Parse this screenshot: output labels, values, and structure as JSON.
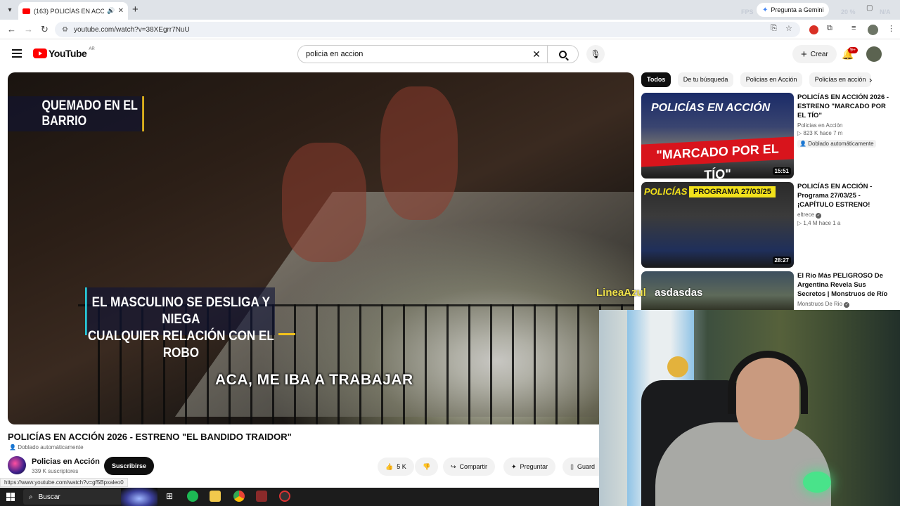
{
  "browser": {
    "tab_title": "(163) POLICÍAS EN ACCIÓN",
    "tab_audio_icon": "speaker-icon",
    "gemini_label": "Pregunta a Gemini",
    "url": "youtube.com/watch?v=38XEgrr7NuU",
    "faint_overlay": [
      "FPS",
      "20 %",
      "N/A"
    ]
  },
  "youtube": {
    "logo_text": "YouTube",
    "country_code": "AR",
    "search_query": "policia en accion",
    "create_label": "Crear",
    "notification_count": "9+",
    "accent_color": "#ff0000"
  },
  "video": {
    "overlay_top": "QUEMADO EN EL BARRIO",
    "overlay_mid_line1": "EL MASCULINO SE DESLIGA Y NIEGA",
    "overlay_mid_line2": "CUALQUIER RELACIÓN CON EL ROBO",
    "subtitle": "ACA, ME IBA A TRABAJAR",
    "title": "POLICÍAS EN ACCIÓN 2026 - ESTRENO \"EL BANDIDO TRAIDOR\"",
    "dubbed": "Doblado automáticamente",
    "channel_name": "Policias en Acción",
    "channel_subs": "339 K suscriptores",
    "subscribe_label": "Suscribirse",
    "likes": "5 K",
    "share_label": "Compartir",
    "ask_label": "Preguntar",
    "save_label": "Guard"
  },
  "status_bar": "https://www.youtube.com/watch?v=gf5Bpxaleo0",
  "chips": [
    "Todos",
    "De tu búsqueda",
    "Policias en Acción",
    "Policías en acción"
  ],
  "related": [
    {
      "title": "POLICÍAS EN ACCIÓN 2026 - ESTRENO \"MARCADO POR EL TÍO\"",
      "channel": "Policias en Acción",
      "views": "823 K",
      "age": "hace 7 m",
      "dubbed": "Doblado automáticamente",
      "duration": "15:51",
      "thumb_brand": "POLICÍAS EN ACCIÓN",
      "thumb_band": "\"MARCADO POR EL TÍO\""
    },
    {
      "title": "POLICÍAS EN ACCIÓN - Programa 27/03/25 - ¡CAPÍTULO ESTRENO!",
      "channel": "eltrece",
      "views": "1,4 M",
      "age": "hace 1 a",
      "duration": "28:27",
      "thumb_brand": "POLICÍAS",
      "thumb_band": "PROGRAMA 27/03/25"
    },
    {
      "title": "El Rio Más PELIGROSO De Argentina Revela Sus Secretos | Monstruos de Río",
      "channel": "Monstruos De Rio"
    }
  ],
  "stream": {
    "label1": "LineaAzul",
    "label1_color": "#f0e24b",
    "label2": "asdasdas",
    "label2_color": "#ffffff"
  },
  "taskbar": {
    "search_label": "Buscar"
  }
}
